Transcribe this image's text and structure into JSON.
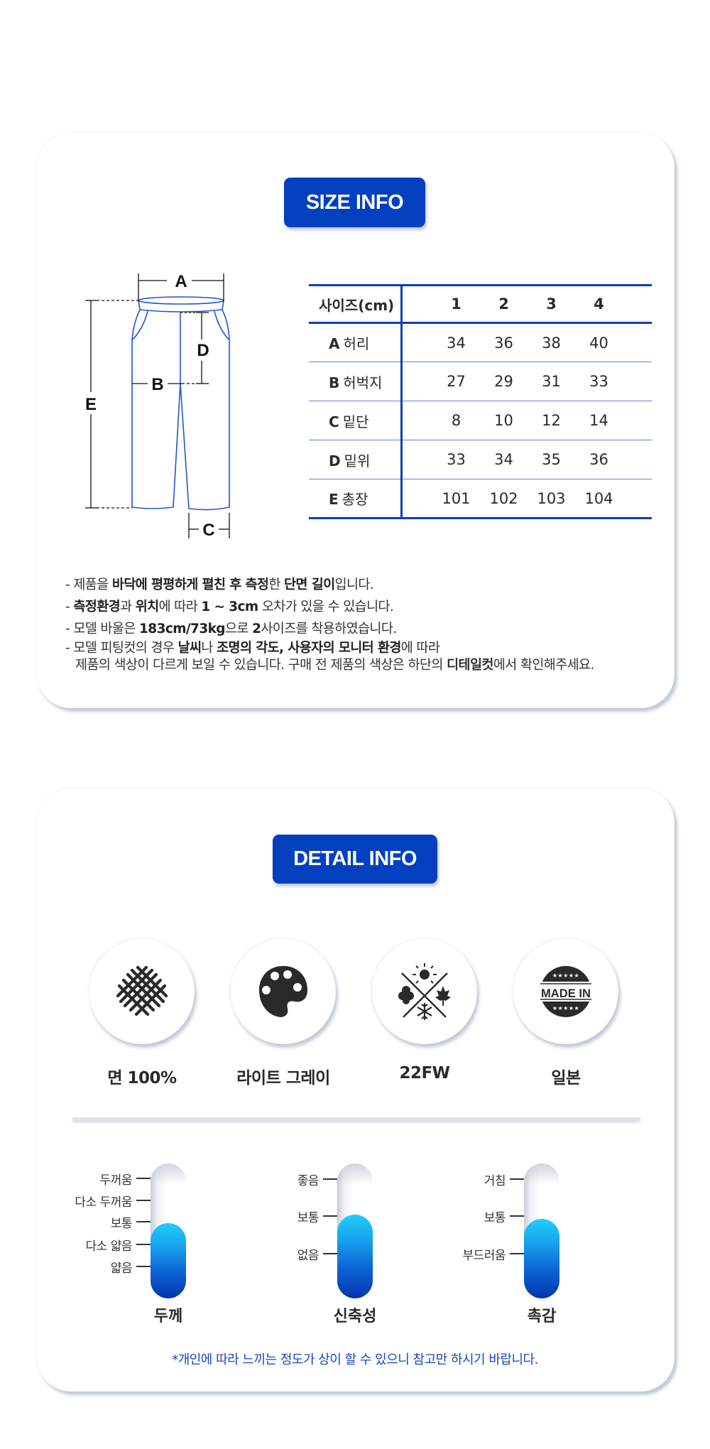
{
  "size_section": {
    "badge": "SIZE INFO",
    "diagram_labels": {
      "a": "A",
      "b": "B",
      "c": "C",
      "d": "D",
      "e": "E"
    },
    "table": {
      "header": {
        "label": "사이즈(cm)",
        "sizes": [
          "1",
          "2",
          "3",
          "4"
        ]
      },
      "rows": [
        {
          "code": "A",
          "name": "허리",
          "values": [
            "34",
            "36",
            "38",
            "40"
          ]
        },
        {
          "code": "B",
          "name": "허벅지",
          "values": [
            "27",
            "29",
            "31",
            "33"
          ]
        },
        {
          "code": "C",
          "name": "밑단",
          "values": [
            "8",
            "10",
            "12",
            "14"
          ]
        },
        {
          "code": "D",
          "name": "밑위",
          "values": [
            "33",
            "34",
            "35",
            "36"
          ]
        },
        {
          "code": "E",
          "name": "총장",
          "values": [
            "101",
            "102",
            "103",
            "104"
          ]
        }
      ]
    },
    "notes": [
      {
        "segments": [
          {
            "text": "- 제품을 ",
            "bold": false
          },
          {
            "text": "바닥에 평평하게 펼친 후 측정",
            "bold": true
          },
          {
            "text": "한 ",
            "bold": false
          },
          {
            "text": "단면 길이",
            "bold": true
          },
          {
            "text": "입니다.",
            "bold": false
          }
        ]
      },
      {
        "segments": [
          {
            "text": "- ",
            "bold": false
          },
          {
            "text": "측정환경",
            "bold": true
          },
          {
            "text": "과 ",
            "bold": false
          },
          {
            "text": "위치",
            "bold": true
          },
          {
            "text": "에 따라 ",
            "bold": false
          },
          {
            "text": "1 ~ 3cm",
            "bold": true
          },
          {
            "text": " 오차가 있을 수 있습니다.",
            "bold": false
          }
        ]
      },
      {
        "segments": [
          {
            "text": "- 모델 바울은 ",
            "bold": false
          },
          {
            "text": "183cm/73kg",
            "bold": true
          },
          {
            "text": "으로 ",
            "bold": false
          },
          {
            "text": "2",
            "bold": true
          },
          {
            "text": "사이즈를 착용하였습니다.",
            "bold": false
          }
        ]
      },
      {
        "segments": [
          {
            "text": "- 모델 피팅컷의 경우 ",
            "bold": false
          },
          {
            "text": "날씨",
            "bold": true
          },
          {
            "text": "나 ",
            "bold": false
          },
          {
            "text": "조명의 각도, 사용자의 모니터 환경",
            "bold": true
          },
          {
            "text": "에 따라",
            "bold": false
          }
        ],
        "continuation": [
          {
            "text": "제품의 색상이 다르게 보일 수 있습니다. 구매 전 제품의 색상은 하단의 ",
            "bold": false
          },
          {
            "text": "디테일컷",
            "bold": true
          },
          {
            "text": "에서 확인해주세요.",
            "bold": false
          }
        ]
      }
    ]
  },
  "detail_section": {
    "badge": "DETAIL INFO",
    "features": [
      {
        "icon": "woven-fabric-icon",
        "label": "면 100%"
      },
      {
        "icon": "palette-icon",
        "label": "라이트 그레이"
      },
      {
        "icon": "four-seasons-icon",
        "label": "22FW"
      },
      {
        "icon": "made-in-badge-icon",
        "label": "일본",
        "icon_text": "MADE IN"
      }
    ],
    "gauges": [
      {
        "title": "두께",
        "ticks": [
          "두꺼움",
          "다소 두꺼움",
          "보통",
          "다소 얇음",
          "얇음"
        ],
        "level": 0.56
      },
      {
        "title": "신축성",
        "ticks": [
          "좋음",
          "보통",
          "없음"
        ],
        "level": 0.62
      },
      {
        "title": "촉감",
        "ticks": [
          "거침",
          "보통",
          "부드러움"
        ],
        "level": 0.59
      }
    ],
    "footnote": "*개인에 따라 느끼는 정도가 상이 할 수 있으니 참고만 하시기 바랍니다."
  },
  "colors": {
    "brand_blue": "#0340bf",
    "table_line": "#0a3fb5",
    "diagram_blue": "#2255d0",
    "footnote_blue": "#1746c2",
    "gauge_top": "#22cdfb",
    "gauge_bottom": "#0434b0"
  }
}
